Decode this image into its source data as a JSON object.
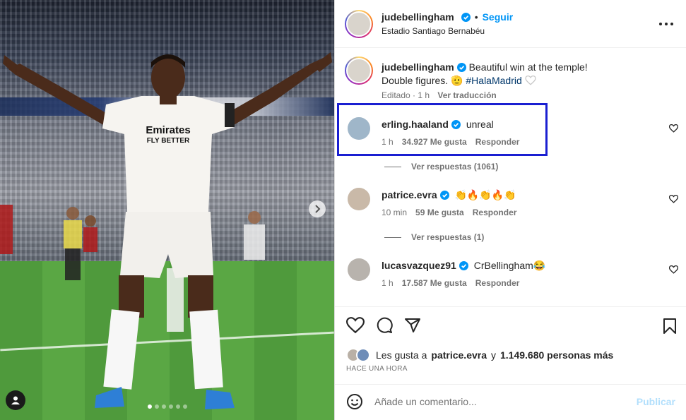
{
  "post": {
    "author": "judebellingham",
    "separator": "•",
    "follow_label": "Seguir",
    "location": "Estadio Santiago Bernabéu",
    "caption_line1": "Beautiful win at the temple!",
    "caption_line2_text": "Double figures. 🫡",
    "hashtag": "#HalaMadrid",
    "caption_meta_edited": "Editado · 1 h",
    "caption_meta_translate": "Ver traducción"
  },
  "carousel": {
    "count": 6,
    "active_index": 0
  },
  "comments": [
    {
      "user": "erling.haaland",
      "text": "unreal",
      "time": "1 h",
      "likes": "34.927 Me gusta",
      "reply": "Responder",
      "replies": "Ver respuestas (1061)",
      "highlighted": true
    },
    {
      "user": "patrice.evra",
      "text": "👏🔥👏🔥👏",
      "time": "10 min",
      "likes": "59 Me gusta",
      "reply": "Responder",
      "replies": "Ver respuestas (1)"
    },
    {
      "user": "lucasvazquez91",
      "text": "CrBellingham😂",
      "time": "1 h",
      "likes": "17.587 Me gusta",
      "reply": "Responder"
    }
  ],
  "likes": {
    "prefix": "Les gusta a",
    "user": "patrice.evra",
    "connector": "y",
    "others": "1.149.680 personas más",
    "timestamp": "HACE UNA HORA"
  },
  "composer": {
    "placeholder": "Añade un comentario...",
    "post_label": "Publicar"
  },
  "colors": {
    "accent": "#0095f6",
    "highlight_box": "#1a1fd1",
    "verified": "#0095f6"
  },
  "icons": [
    "more-options-icon",
    "verified-badge-icon",
    "heart-icon",
    "comment-icon",
    "share-icon",
    "bookmark-icon",
    "emoji-icon",
    "next-arrow-icon",
    "user-tag-icon"
  ]
}
